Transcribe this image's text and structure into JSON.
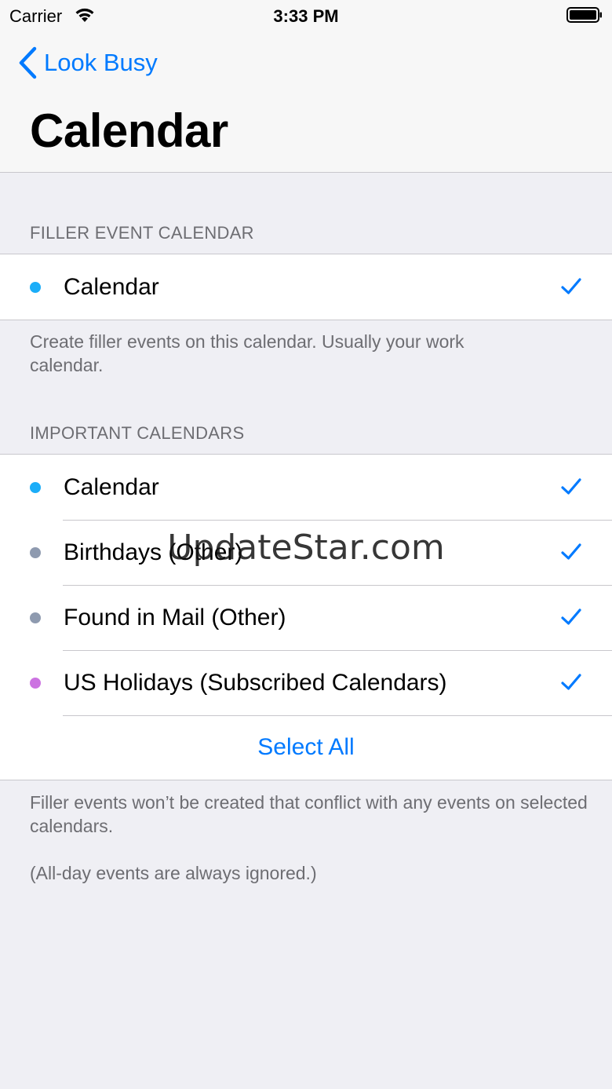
{
  "status_bar": {
    "carrier": "Carrier",
    "time": "3:33 PM"
  },
  "nav": {
    "back_label": "Look Busy",
    "title": "Calendar"
  },
  "filler_section": {
    "header": "FILLER EVENT CALENDAR",
    "items": [
      {
        "label": "Calendar",
        "color": "#1badf8",
        "checked": true
      }
    ],
    "footer": "Create filler events on this calendar. Usually your work calendar."
  },
  "important_section": {
    "header": "IMPORTANT CALENDARS",
    "items": [
      {
        "label": "Calendar",
        "color": "#1badf8",
        "checked": true
      },
      {
        "label": "Birthdays (Other)",
        "color": "#8e9aaf",
        "checked": true
      },
      {
        "label": "Found in Mail (Other)",
        "color": "#8e9aaf",
        "checked": true
      },
      {
        "label": "US Holidays (Subscribed Calendars)",
        "color": "#cc73e1",
        "checked": true
      }
    ],
    "select_all": "Select All",
    "footer_1": "Filler events won’t be created that conflict with any events on selected calendars.",
    "footer_2": "(All-day events are always ignored.)"
  },
  "watermark": "UpdateStar.com",
  "colors": {
    "accent": "#007aff",
    "background": "#efeff4"
  }
}
